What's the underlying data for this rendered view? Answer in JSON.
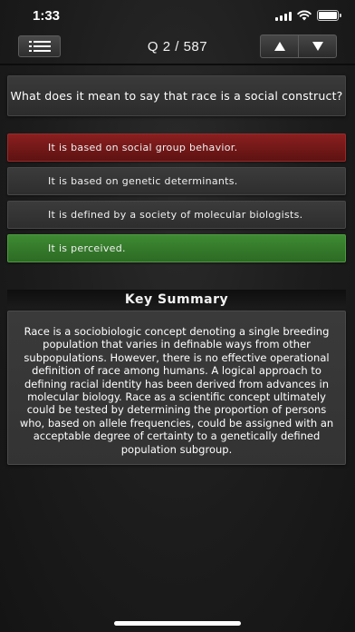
{
  "status_bar": {
    "time": "1:33"
  },
  "nav": {
    "question_counter": "Q 2 / 587",
    "menu_icon": "list-icon",
    "up_icon": "triangle-up-icon",
    "down_icon": "triangle-down-icon"
  },
  "question": {
    "text": "What does it mean to say that race is a social construct?"
  },
  "answers": [
    {
      "text": "It is based on social group behavior.",
      "state": "wrong"
    },
    {
      "text": "It is based on genetic determinants.",
      "state": "neutral"
    },
    {
      "text": "It is defined by a society of molecular biologists.",
      "state": "neutral"
    },
    {
      "text": "It is perceived.",
      "state": "correct"
    }
  ],
  "summary": {
    "title": "Key Summary",
    "body": "Race is a sociobiologic concept denoting a single breeding population that varies in definable ways from other subpopulations. However, there is no effective operational definition of race among humans. A logical approach to defining racial identity has been derived from advances in molecular biology. Race as a scientific concept ultimately could be tested by determining the proportion of persons who, based on allele frequencies, could be assigned with an acceptable degree of certainty to a genetically defined population subgroup."
  },
  "colors": {
    "wrong": "#7a1a1a",
    "correct": "#357a2b",
    "neutral": "#333333"
  }
}
